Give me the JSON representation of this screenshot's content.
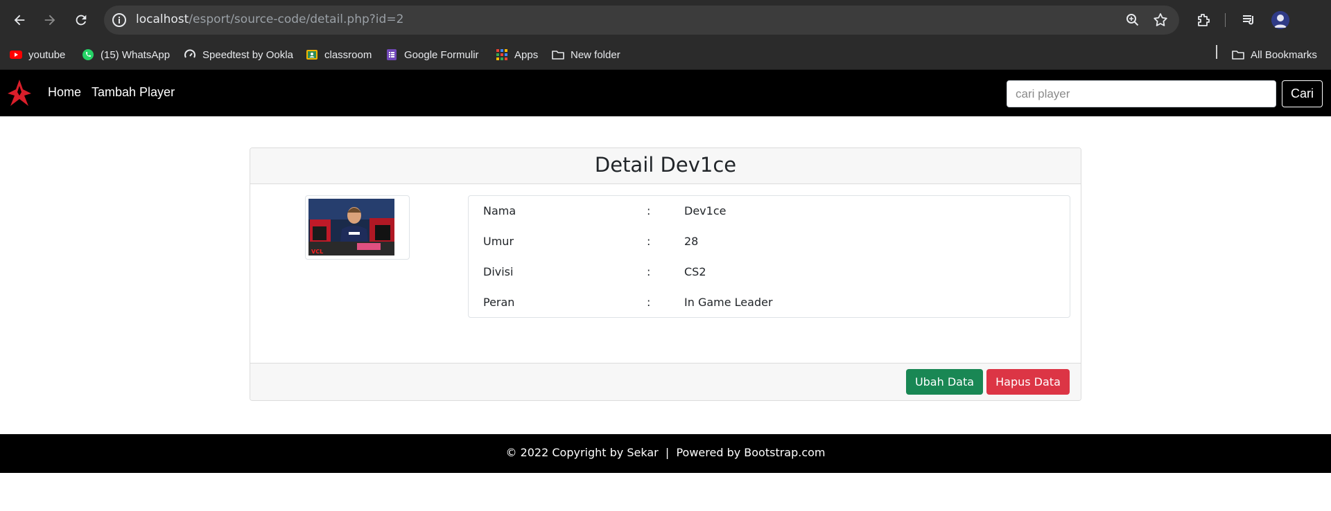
{
  "browser": {
    "url_host": "localhost",
    "url_path": "/esport/source-code/detail.php?id=2",
    "bookmarks": [
      {
        "label": "youtube",
        "icon": "youtube-icon"
      },
      {
        "label": "(15) WhatsApp",
        "icon": "whatsapp-icon"
      },
      {
        "label": "Speedtest by Ookla",
        "icon": "speedtest-icon"
      },
      {
        "label": "classroom",
        "icon": "classroom-icon"
      },
      {
        "label": "Google Formulir",
        "icon": "google-forms-icon"
      },
      {
        "label": "Apps",
        "icon": "apps-grid-icon"
      },
      {
        "label": "New folder",
        "icon": "folder-icon"
      }
    ],
    "all_bookmarks_label": "All Bookmarks"
  },
  "navbar": {
    "home_label": "Home",
    "add_player_label": "Tambah Player",
    "search_placeholder": "cari player",
    "search_button_label": "Cari"
  },
  "detail": {
    "title": "Detail Dev1ce",
    "rows": [
      {
        "label": "Nama",
        "sep": ":",
        "value": "Dev1ce"
      },
      {
        "label": "Umur",
        "sep": ":",
        "value": "28"
      },
      {
        "label": "Divisi",
        "sep": ":",
        "value": "CS2"
      },
      {
        "label": "Peran",
        "sep": ":",
        "value": "In Game Leader"
      }
    ],
    "edit_button_label": "Ubah Data",
    "delete_button_label": "Hapus Data"
  },
  "footer": {
    "text": "© 2022 Copyright by Sekar  |  Powered by Bootstrap.com"
  },
  "colors": {
    "edit_button": "#198754",
    "delete_button": "#dc3545",
    "navbar_bg": "#000000",
    "brand_logo": "#d91e2a"
  }
}
